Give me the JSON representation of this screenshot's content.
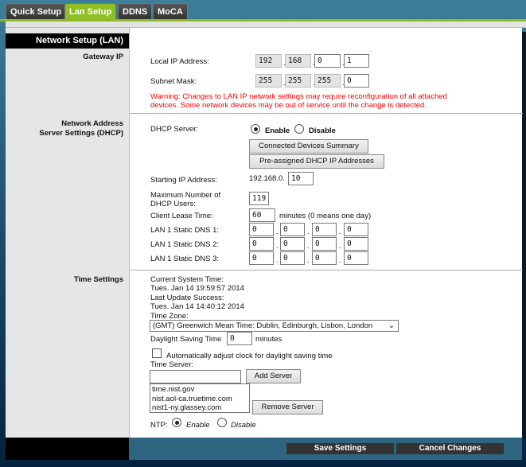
{
  "tabs": [
    "Quick Setup",
    "Lan Setup",
    "DDNS",
    "MoCA"
  ],
  "active_tab": "Lan Setup",
  "sections": {
    "lan": {
      "header": "Network Setup (LAN)",
      "label": "Gateway IP",
      "local_ip_label": "Local IP Address:",
      "local_ip": [
        "192",
        "168",
        "0",
        "1"
      ],
      "subnet_label": "Subnet Mask:",
      "subnet": [
        "255",
        "255",
        "255",
        "0"
      ],
      "warning": "Warning: Changes to LAN IP network settings may require reconfiguration of all attached devices. Some network devices may be out of service until the change is detected."
    },
    "dhcp": {
      "label_line1": "Network Address",
      "label_line2": "Server Settings (DHCP)",
      "server_label": "DHCP Server:",
      "enable": "Enable",
      "disable": "Disable",
      "enabled": true,
      "connected_btn": "Connected Devices Summary",
      "preassigned_btn": "Pre-assigned DHCP IP Addresses",
      "start_label": "Starting IP Address:",
      "start_prefix": "192.168.0.",
      "start_value": "10",
      "max_label_1": "Maximum Number of",
      "max_label_2": "DHCP Users:",
      "max_value": "119",
      "lease_label": "Client Lease Time:",
      "lease_value": "60",
      "lease_unit": "minutes (0 means one day)",
      "dns": [
        {
          "label": "LAN 1 Static DNS 1:",
          "values": [
            "0",
            "0",
            "0",
            "0"
          ]
        },
        {
          "label": "LAN 1 Static DNS 2:",
          "values": [
            "0",
            "0",
            "0",
            "0"
          ]
        },
        {
          "label": "LAN 1 Static DNS 3:",
          "values": [
            "0",
            "0",
            "0",
            "0"
          ]
        }
      ]
    },
    "time": {
      "label": "Time Settings",
      "current_label": "Current System Time:",
      "current_value": "Tues. Jan 14 19:59:57 2014",
      "last_label": "Last Update Success:",
      "last_value": "Tues. Jan 14 14:40:12 2014",
      "tz_label": "Time Zone:",
      "tz_value": "(GMT) Greenwich Mean Time: Dublin, Edinburgh, Lisbon, London",
      "dst_label": "Daylight Saving Time",
      "dst_value": "0",
      "dst_unit": "minutes",
      "auto_adjust": "Automatically adjust clock for daylight saving time",
      "auto_checked": false,
      "server_label": "Time Server:",
      "server_input": "",
      "add_btn": "Add Server",
      "servers": [
        "time.nist.gov",
        "nist.aol-ca.truetime.com",
        "nist1-ny.glassey.com"
      ],
      "remove_btn": "Remove Server",
      "ntp_label": "NTP:",
      "ntp_enable": "Enable",
      "ntp_disable": "Disable",
      "ntp_enabled": true
    }
  },
  "footer": {
    "save": "Save Settings",
    "cancel": "Cancel Changes"
  }
}
